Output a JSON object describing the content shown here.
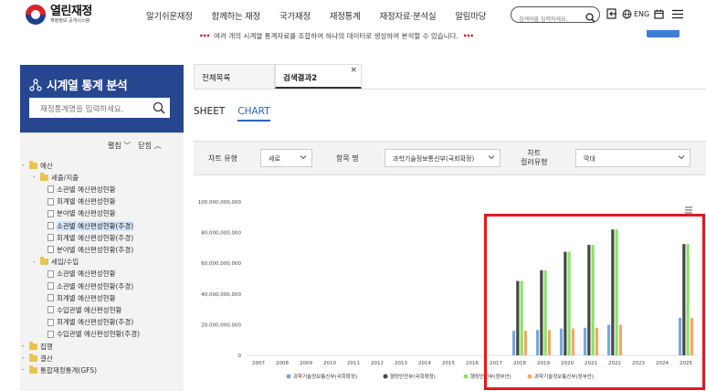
{
  "header": {
    "logo_title": "열린재정",
    "logo_sub": "재정정보 공개시스템",
    "nav": [
      "알기쉬운재정",
      "함께하는 재정",
      "국가재정",
      "재정통계",
      "재정자료·분석실",
      "알림마당"
    ],
    "search_placeholder": "검색어를 입력하세요.",
    "lang_label": "ENG"
  },
  "notice": {
    "text": "여러 개의 시계열 통계자료를 조합하여 하나의 데이터로 생성하여 분석할 수 있습니다."
  },
  "left_panel": {
    "title": "시계열 통계 분석",
    "search_placeholder": "재정통계명을 입력하세요.",
    "expand_label": "펼침",
    "collapse_label": "닫힘"
  },
  "tree": [
    {
      "label": "예산",
      "type": "folder",
      "level": 0,
      "open": true
    },
    {
      "label": "세출/지출",
      "type": "folder",
      "level": 1,
      "open": true
    },
    {
      "label": "소관별 예산편성현황",
      "type": "doc",
      "level": 2
    },
    {
      "label": "회계별 예산편성현황",
      "type": "doc",
      "level": 2
    },
    {
      "label": "분야별 예산편성현황",
      "type": "doc",
      "level": 2
    },
    {
      "label": "소관별 예산편성현황(추경)",
      "type": "doc",
      "level": 2,
      "selected": true
    },
    {
      "label": "회계별 예산편성현황(추경)",
      "type": "doc",
      "level": 2
    },
    {
      "label": "분야별 예산편성현황(추경)",
      "type": "doc",
      "level": 2
    },
    {
      "label": "세입/수입",
      "type": "folder",
      "level": 1,
      "open": true
    },
    {
      "label": "소관별 예산편성현황",
      "type": "doc",
      "level": 2
    },
    {
      "label": "소관별 예산편성현황(추경)",
      "type": "doc",
      "level": 2
    },
    {
      "label": "회계별 예산편성현황",
      "type": "doc",
      "level": 2
    },
    {
      "label": "수입관별 예산편성현황",
      "type": "doc",
      "level": 2
    },
    {
      "label": "회계별 예산편성현황(추경)",
      "type": "doc",
      "level": 2
    },
    {
      "label": "수입관별 예산편성현황(추경)",
      "type": "doc",
      "level": 2
    },
    {
      "label": "집행",
      "type": "folder",
      "level": 0
    },
    {
      "label": "결산",
      "type": "folder",
      "level": 0
    },
    {
      "label": "통합재정통계(GFS)",
      "type": "folder",
      "level": 0
    }
  ],
  "tabs": [
    {
      "label": "전체목록"
    },
    {
      "label": "검색결과2",
      "close": "×"
    }
  ],
  "subtabs": {
    "sheet": "SHEET",
    "chart": "CHART"
  },
  "filters": {
    "chart_type_label": "차트 유형",
    "chart_type_value": "세로",
    "item_label": "항목 명",
    "item_value": "과학기술정보통신부(국회확정)",
    "color_type_label_1": "차트",
    "color_type_label_2": "컬러유형",
    "color_type_value": "막대"
  },
  "colors": {
    "s1": "#7ba7dc",
    "s2": "#454545",
    "s3": "#8ee06b",
    "s4": "#f5a868",
    "highlight": "#e8161d"
  },
  "chart_data": {
    "type": "bar",
    "title": "",
    "categories": [
      "2007",
      "2008",
      "2009",
      "2010",
      "2011",
      "2012",
      "2013",
      "2014",
      "2015",
      "2016",
      "2017",
      "2018",
      "2019",
      "2020",
      "2021",
      "2022",
      "2023",
      "2024",
      "2025"
    ],
    "ylim": [
      0,
      100000000000
    ],
    "yticks": [
      "0",
      "20,000,000,000",
      "40,000,000,000",
      "60,000,000,000",
      "80,000,000,000",
      "100,000,000,000"
    ],
    "series": [
      {
        "name": "과학기술정보통신부(국회확정)",
        "values": [
          0,
          0,
          0,
          0,
          0,
          0,
          0,
          0,
          0,
          0,
          0,
          16000000000,
          16500000000,
          17500000000,
          18000000000,
          20000000000,
          0,
          0,
          24500000000
        ]
      },
      {
        "name": "행정안전부(국회확정)",
        "values": [
          0,
          0,
          0,
          0,
          0,
          0,
          0,
          0,
          0,
          0,
          0,
          48500000000,
          55500000000,
          67500000000,
          72000000000,
          82000000000,
          0,
          0,
          72500000000
        ]
      },
      {
        "name": "행정안전부(정부안)",
        "values": [
          0,
          0,
          0,
          0,
          0,
          0,
          0,
          0,
          0,
          0,
          0,
          48500000000,
          55500000000,
          67500000000,
          72000000000,
          82000000000,
          0,
          0,
          72500000000
        ]
      },
      {
        "name": "과학기술정보통신부(정부안)",
        "values": [
          0,
          0,
          0,
          0,
          0,
          0,
          0,
          0,
          0,
          0,
          0,
          16000000000,
          16500000000,
          17500000000,
          18000000000,
          20000000000,
          0,
          0,
          24500000000
        ]
      }
    ],
    "legend": "bottom",
    "grid": false
  }
}
